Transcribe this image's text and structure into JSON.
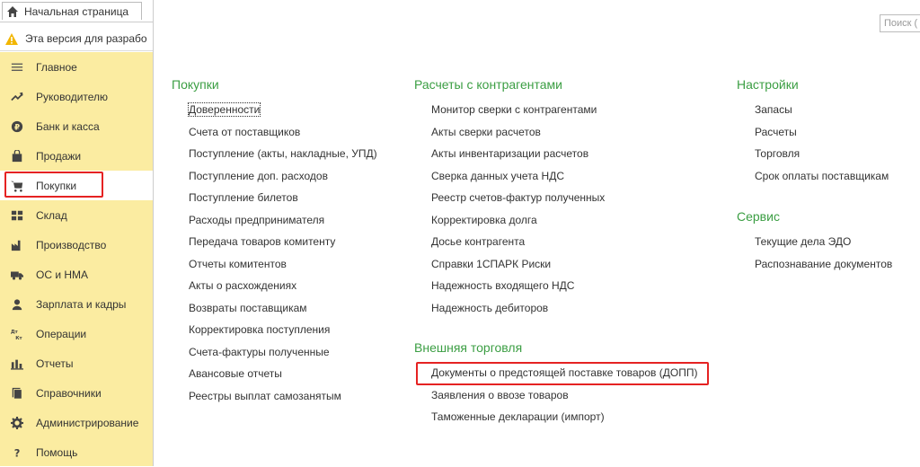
{
  "tab": {
    "title": "Начальная страница"
  },
  "warning": {
    "text": "Эта версия для разрабо"
  },
  "search": {
    "placeholder": "Поиск ("
  },
  "sidebar": {
    "items": [
      {
        "label": "Главное",
        "icon": "menu-icon"
      },
      {
        "label": "Руководителю",
        "icon": "trend-icon"
      },
      {
        "label": "Банк и касса",
        "icon": "ruble-icon"
      },
      {
        "label": "Продажи",
        "icon": "bag-icon"
      },
      {
        "label": "Покупки",
        "icon": "cart-icon"
      },
      {
        "label": "Склад",
        "icon": "grid-icon"
      },
      {
        "label": "Производство",
        "icon": "factory-icon"
      },
      {
        "label": "ОС и НМА",
        "icon": "truck-icon"
      },
      {
        "label": "Зарплата и кадры",
        "icon": "person-icon"
      },
      {
        "label": "Операции",
        "icon": "dt-kt-icon"
      },
      {
        "label": "Отчеты",
        "icon": "bar-chart-icon"
      },
      {
        "label": "Справочники",
        "icon": "books-icon"
      },
      {
        "label": "Администрирование",
        "icon": "gear-icon"
      },
      {
        "label": "Помощь",
        "icon": "question-icon"
      }
    ]
  },
  "sections": {
    "purchases": {
      "title": "Покупки",
      "links": [
        "Доверенности",
        "Счета от поставщиков",
        "Поступление (акты, накладные, УПД)",
        "Поступление доп. расходов",
        "Поступление билетов",
        "Расходы предпринимателя",
        "Передача товаров комитенту",
        "Отчеты комитентов",
        "Акты о расхождениях",
        "Возвраты поставщикам",
        "Корректировка поступления",
        "Счета-фактуры полученные",
        "Авансовые отчеты",
        "Реестры выплат самозанятым"
      ]
    },
    "settlements": {
      "title": "Расчеты с контрагентами",
      "links": [
        "Монитор сверки с контрагентами",
        "Акты сверки расчетов",
        "Акты инвентаризации расчетов",
        "Сверка данных учета НДС",
        "Реестр счетов-фактур полученных",
        "Корректировка долга",
        "Досье контрагента",
        "Справки 1СПАРК Риски",
        "Надежность входящего НДС",
        "Надежность дебиторов"
      ]
    },
    "foreign": {
      "title": "Внешняя торговля",
      "links": [
        "Документы о предстоящей поставке товаров (ДОПП)",
        "Заявления о ввозе товаров",
        "Таможенные декларации (импорт)"
      ]
    },
    "settings": {
      "title": "Настройки",
      "links": [
        "Запасы",
        "Расчеты",
        "Торговля",
        "Срок оплаты поставщикам"
      ]
    },
    "service": {
      "title": "Сервис",
      "links": [
        "Текущие дела ЭДО",
        "Распознавание документов"
      ]
    }
  },
  "colors": {
    "sidebar": "#fbeca1",
    "heading": "#3b9e43",
    "highlight": "#e52222"
  }
}
